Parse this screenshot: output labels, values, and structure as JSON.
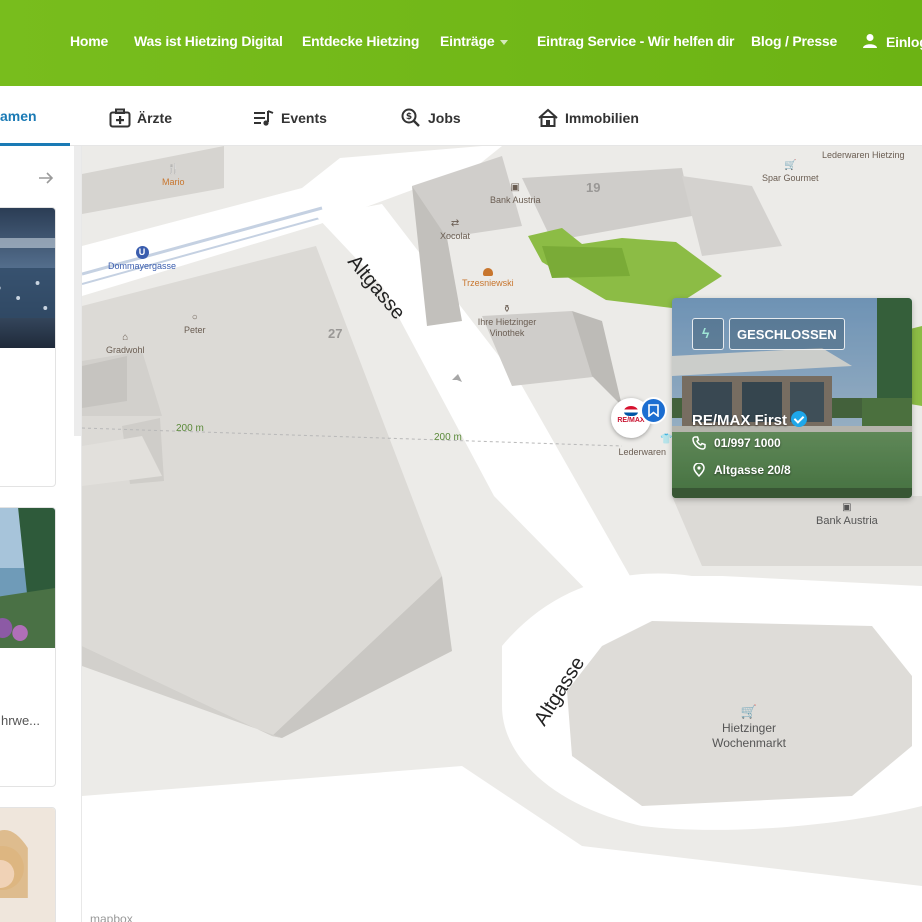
{
  "topnav": {
    "items": [
      {
        "label": "Home"
      },
      {
        "label": "Was ist Hietzing Digital"
      },
      {
        "label": "Entdecke Hietzing"
      },
      {
        "label": "Einträge"
      },
      {
        "label": "Eintrag Service - Wir helfen dir"
      },
      {
        "label": "Blog / Presse"
      }
    ],
    "login_label": "Einlog",
    "color": "#74b81b"
  },
  "categories": {
    "active_partial": "amen",
    "items": [
      {
        "label": "Ärzte",
        "icon": "medical-kit-icon"
      },
      {
        "label": "Events",
        "icon": "music-note-icon"
      },
      {
        "label": "Jobs",
        "icon": "search-dollar-icon"
      },
      {
        "label": "Immobilien",
        "icon": "house-icon"
      }
    ],
    "active_color": "#1a7ab5"
  },
  "leftpanel": {
    "snippet": "hrwe..."
  },
  "map": {
    "streets": [
      "Altgasse",
      "Altgasse"
    ],
    "house_numbers": [
      "19",
      "27"
    ],
    "scale_labels": [
      "200 m",
      "200 m"
    ],
    "pois": [
      {
        "label": "Mario",
        "icon": "restaurant-icon"
      },
      {
        "label": "Dommayergasse",
        "icon": "subway-icon"
      },
      {
        "label": "Peter",
        "icon": "ring-icon"
      },
      {
        "label": "Gradwohl",
        "icon": "bakery-icon"
      },
      {
        "label": "Xocolat",
        "icon": "exchange-icon"
      },
      {
        "label": "Bank Austria",
        "icon": "bank-icon"
      },
      {
        "label": "Trzesniewski",
        "icon": "burger-icon"
      },
      {
        "label": "Ihre Hietzinger Vinothek",
        "icon": "wine-icon"
      },
      {
        "label": "Spar Gourmet",
        "icon": "cart-icon"
      },
      {
        "label": "Lederwaren Hietzing"
      },
      {
        "label": "Lederwaren",
        "icon": "shirt-icon"
      },
      {
        "label": "Bank Austria",
        "icon": "bank-icon"
      },
      {
        "label": "Hietzinger Wochenmarkt",
        "icon": "cart-icon"
      }
    ],
    "attribution": "mapbox"
  },
  "marker": {
    "logo_text": "RE/MAX",
    "badge_icon": "bookmark-icon"
  },
  "infocard": {
    "status": "GESCHLOSSEN",
    "title": "RE/MAX First",
    "phone": "01/997 1000",
    "address": "Altgasse 20/8"
  }
}
